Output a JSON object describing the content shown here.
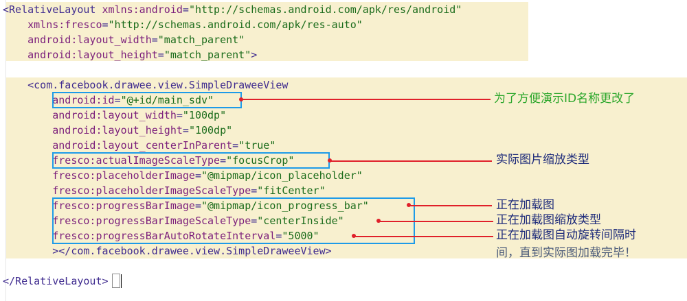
{
  "editor": {
    "lines": [
      {
        "indent": "",
        "parts": [
          [
            "tag",
            "<RelativeLayout "
          ],
          [
            "attr",
            "xmlns:android"
          ],
          [
            "tag",
            "="
          ],
          [
            "val",
            "\"http://schemas.android.com/apk/res/android\""
          ]
        ]
      },
      {
        "indent": "    ",
        "parts": [
          [
            "attr",
            "xmlns:fresco"
          ],
          [
            "tag",
            "="
          ],
          [
            "val",
            "\"http://schemas.android.com/apk/res-auto\""
          ]
        ]
      },
      {
        "indent": "    ",
        "parts": [
          [
            "attr",
            "android:layout_width"
          ],
          [
            "tag",
            "="
          ],
          [
            "val",
            "\"match_parent\""
          ]
        ]
      },
      {
        "indent": "    ",
        "parts": [
          [
            "attr",
            "android:layout_height"
          ],
          [
            "tag",
            "="
          ],
          [
            "val",
            "\"match_parent\""
          ],
          [
            "tag",
            ">"
          ]
        ]
      },
      {
        "indent": "",
        "parts": []
      },
      {
        "indent": "    ",
        "parts": [
          [
            "tag",
            "<com.facebook.drawee.view.SimpleDraweeView"
          ]
        ]
      },
      {
        "indent": "        ",
        "parts": [
          [
            "attr",
            "android:id"
          ],
          [
            "tag",
            "="
          ],
          [
            "val",
            "\"@+id/main_sdv\""
          ]
        ]
      },
      {
        "indent": "        ",
        "parts": [
          [
            "attr",
            "android:layout_width"
          ],
          [
            "tag",
            "="
          ],
          [
            "val",
            "\"100dp\""
          ]
        ]
      },
      {
        "indent": "        ",
        "parts": [
          [
            "attr",
            "android:layout_height"
          ],
          [
            "tag",
            "="
          ],
          [
            "val",
            "\"100dp\""
          ]
        ]
      },
      {
        "indent": "        ",
        "parts": [
          [
            "attr",
            "android:layout_centerInParent"
          ],
          [
            "tag",
            "="
          ],
          [
            "val",
            "\"true\""
          ]
        ]
      },
      {
        "indent": "        ",
        "parts": [
          [
            "attr",
            "fresco:actualImageScaleType"
          ],
          [
            "tag",
            "="
          ],
          [
            "val",
            "\"focusCrop\""
          ]
        ]
      },
      {
        "indent": "        ",
        "parts": [
          [
            "attr",
            "fresco:placeholderImage"
          ],
          [
            "tag",
            "="
          ],
          [
            "val",
            "\"@mipmap/icon_placeholder\""
          ]
        ]
      },
      {
        "indent": "        ",
        "parts": [
          [
            "attr",
            "fresco:placeholderImageScaleType"
          ],
          [
            "tag",
            "="
          ],
          [
            "val",
            "\"fitCenter\""
          ]
        ]
      },
      {
        "indent": "        ",
        "parts": [
          [
            "attr",
            "fresco:progressBarImage"
          ],
          [
            "tag",
            "="
          ],
          [
            "val",
            "\"@mipmap/icon_progress_bar\""
          ]
        ]
      },
      {
        "indent": "        ",
        "parts": [
          [
            "attr",
            "fresco:progressBarImageScaleType"
          ],
          [
            "tag",
            "="
          ],
          [
            "val",
            "\"centerInside\""
          ]
        ]
      },
      {
        "indent": "        ",
        "parts": [
          [
            "attr",
            "fresco:progressBarAutoRotateInterval"
          ],
          [
            "tag",
            "="
          ],
          [
            "val",
            "\"5000\""
          ]
        ]
      },
      {
        "indent": "        ",
        "parts": [
          [
            "tag",
            "></com.facebook.drawee.view.SimpleDraweeView>"
          ]
        ]
      },
      {
        "indent": "",
        "parts": []
      },
      {
        "indent": "",
        "parts": [
          [
            "tag",
            "</RelativeLayout>"
          ]
        ]
      }
    ]
  },
  "annotations": {
    "id_note": "为了方便演示ID名称更改了",
    "scale_type_note": "实际图片缩放类型",
    "progress_image_note": "正在加载图",
    "progress_scale_note": "正在加载图缩放类型",
    "rotate_note_1": "正在加载图自动旋转间隔时",
    "rotate_note_2": "间，直到实际图加载完毕！"
  },
  "colors": {
    "highlight": "#f8f0cf",
    "box": "#1e9be8",
    "arrow": "#e0202a",
    "note_green": "#2aa62a",
    "note_dark": "#1d2a7a"
  }
}
